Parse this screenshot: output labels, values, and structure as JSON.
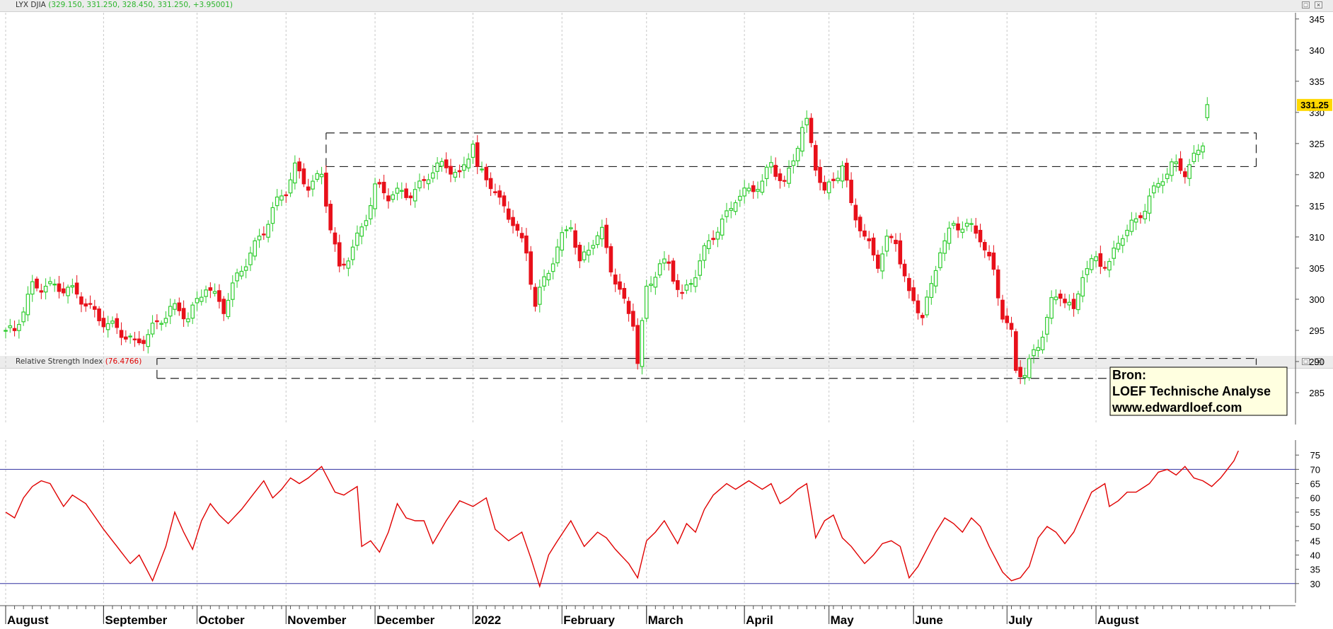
{
  "panels": {
    "price": {
      "symbol": "LYX DJIA",
      "values_text": "(329.150, 331.250, 328.450, 331.250, +3.95001)",
      "values_color": "#2bb52b",
      "last_price": "331.25",
      "last_price_bg": "#ffd800"
    },
    "rsi": {
      "title": "Relative Strength Index",
      "value_text": "(76.4766)",
      "value_color": "#e00000"
    }
  },
  "window_buttons": {
    "restore": "□",
    "close": "×"
  },
  "source_box": {
    "line1": "Bron:",
    "line2": "LOEF Technische Analyse",
    "line3": "www.edwardloef.com"
  },
  "colors": {
    "up": "#2ecc2e",
    "down": "#e8101a",
    "rsi_line": "#e00000",
    "rsi_levels": "#3030a0",
    "grid": "#c8c8c8"
  },
  "chart_data": [
    {
      "type": "candlestick",
      "y_ticks": [
        "285",
        "290",
        "295",
        "300",
        "305",
        "310",
        "315",
        "320",
        "325",
        "330",
        "335",
        "340",
        "345"
      ],
      "ylim": [
        280,
        346
      ],
      "x_labels": [
        "August",
        "September",
        "October",
        "November",
        "December",
        "2022",
        "February",
        "March",
        "April",
        "May",
        "June",
        "July",
        "August"
      ],
      "month_positions": [
        0,
        22,
        43,
        63,
        83,
        105,
        125,
        144,
        166,
        185,
        204,
        225,
        245
      ],
      "anchors": [
        [
          0,
          295
        ],
        [
          2,
          294
        ],
        [
          6,
          302
        ],
        [
          9,
          303
        ],
        [
          14,
          301
        ],
        [
          19,
          299
        ],
        [
          22,
          297
        ],
        [
          26,
          294
        ],
        [
          29,
          292.5
        ],
        [
          33,
          296
        ],
        [
          37,
          298
        ],
        [
          41,
          297
        ],
        [
          45,
          303
        ],
        [
          49,
          298
        ],
        [
          52,
          303
        ],
        [
          55,
          308
        ],
        [
          60,
          314
        ],
        [
          63,
          317
        ],
        [
          65,
          321
        ],
        [
          68,
          319
        ],
        [
          71,
          320
        ],
        [
          73,
          311
        ],
        [
          75,
          304
        ],
        [
          77,
          307
        ],
        [
          80,
          312
        ],
        [
          83,
          318
        ],
        [
          86,
          316
        ],
        [
          89,
          317
        ],
        [
          92,
          318
        ],
        [
          95,
          320
        ],
        [
          99,
          321
        ],
        [
          102,
          320
        ],
        [
          105,
          326
        ],
        [
          106,
          321
        ],
        [
          109,
          318
        ],
        [
          111,
          315
        ],
        [
          114,
          313
        ],
        [
          117,
          308
        ],
        [
          119,
          299
        ],
        [
          122,
          304
        ],
        [
          125,
          310
        ],
        [
          127,
          313
        ],
        [
          129,
          306
        ],
        [
          132,
          309
        ],
        [
          134,
          310
        ],
        [
          136,
          305
        ],
        [
          139,
          300
        ],
        [
          141,
          297
        ],
        [
          142,
          290
        ],
        [
          144,
          301
        ],
        [
          147,
          305
        ],
        [
          149,
          306
        ],
        [
          152,
          301
        ],
        [
          155,
          304
        ],
        [
          157,
          307
        ],
        [
          159,
          310
        ],
        [
          162,
          314
        ],
        [
          164,
          317
        ],
        [
          167,
          317
        ],
        [
          170,
          318
        ],
        [
          172,
          322
        ],
        [
          175,
          319
        ],
        [
          177,
          323
        ],
        [
          179,
          327
        ],
        [
          180,
          327.5
        ],
        [
          182,
          321
        ],
        [
          184,
          317
        ],
        [
          186,
          320
        ],
        [
          188,
          322
        ],
        [
          190,
          315
        ],
        [
          193,
          309
        ],
        [
          196,
          306
        ],
        [
          198,
          310
        ],
        [
          200,
          310
        ],
        [
          203,
          300
        ],
        [
          206,
          297
        ],
        [
          208,
          302
        ],
        [
          210,
          309
        ],
        [
          213,
          312
        ],
        [
          216,
          311
        ],
        [
          219,
          310
        ],
        [
          222,
          305
        ],
        [
          224,
          298
        ],
        [
          226,
          294
        ],
        [
          227,
          288
        ],
        [
          229,
          287.5
        ],
        [
          232,
          293
        ],
        [
          235,
          300
        ],
        [
          237,
          301
        ],
        [
          240,
          297
        ],
        [
          242,
          304
        ],
        [
          245,
          307
        ],
        [
          248,
          306
        ],
        [
          251,
          310
        ],
        [
          254,
          312
        ],
        [
          257,
          317
        ],
        [
          260,
          320
        ],
        [
          262,
          321
        ],
        [
          265,
          320
        ],
        [
          268,
          324
        ],
        [
          269,
          326
        ],
        [
          270,
          331.25
        ]
      ],
      "resistance_band": [
        321.3,
        326.7
      ],
      "resistance_band_x": [
        72,
        281
      ],
      "support_band": [
        287.3,
        290.5
      ],
      "support_band_x": [
        34,
        281
      ]
    },
    {
      "type": "line",
      "title": "Relative Strength Index",
      "y_ticks": [
        "30",
        "35",
        "40",
        "45",
        "50",
        "55",
        "60",
        "65",
        "70",
        "75"
      ],
      "ylim": [
        24,
        80
      ],
      "levels": [
        30,
        70
      ],
      "current": 76.4766,
      "anchors": [
        [
          0,
          55
        ],
        [
          2,
          53
        ],
        [
          4,
          60
        ],
        [
          6,
          64
        ],
        [
          8,
          66
        ],
        [
          10,
          65
        ],
        [
          13,
          57
        ],
        [
          15,
          61
        ],
        [
          18,
          58
        ],
        [
          22,
          49
        ],
        [
          25,
          43
        ],
        [
          28,
          37
        ],
        [
          30,
          40
        ],
        [
          33,
          31
        ],
        [
          36,
          43
        ],
        [
          38,
          55
        ],
        [
          40,
          48
        ],
        [
          42,
          42
        ],
        [
          44,
          52
        ],
        [
          46,
          58
        ],
        [
          48,
          54
        ],
        [
          50,
          51
        ],
        [
          53,
          56
        ],
        [
          56,
          62
        ],
        [
          58,
          66
        ],
        [
          60,
          60
        ],
        [
          62,
          63
        ],
        [
          64,
          67
        ],
        [
          66,
          65
        ],
        [
          68,
          67
        ],
        [
          71,
          71
        ],
        [
          74,
          62
        ],
        [
          76,
          61
        ],
        [
          79,
          64
        ],
        [
          80,
          43
        ],
        [
          82,
          45
        ],
        [
          84,
          41
        ],
        [
          86,
          48
        ],
        [
          88,
          58
        ],
        [
          90,
          53
        ],
        [
          92,
          52
        ],
        [
          94,
          52
        ],
        [
          96,
          44
        ],
        [
          99,
          52
        ],
        [
          102,
          59
        ],
        [
          105,
          57
        ],
        [
          108,
          60
        ],
        [
          110,
          49
        ],
        [
          113,
          45
        ],
        [
          116,
          48
        ],
        [
          118,
          39
        ],
        [
          120,
          29
        ],
        [
          122,
          40
        ],
        [
          124,
          45
        ],
        [
          127,
          52
        ],
        [
          130,
          43
        ],
        [
          133,
          48
        ],
        [
          135,
          46
        ],
        [
          137,
          42
        ],
        [
          140,
          37
        ],
        [
          142,
          32
        ],
        [
          144,
          45
        ],
        [
          146,
          48
        ],
        [
          148,
          52
        ],
        [
          151,
          44
        ],
        [
          153,
          51
        ],
        [
          155,
          48
        ],
        [
          157,
          56
        ],
        [
          159,
          61
        ],
        [
          162,
          65
        ],
        [
          164,
          63
        ],
        [
          167,
          66
        ],
        [
          170,
          63
        ],
        [
          172,
          65
        ],
        [
          174,
          58
        ],
        [
          176,
          60
        ],
        [
          178,
          63
        ],
        [
          180,
          65
        ],
        [
          182,
          46
        ],
        [
          184,
          52
        ],
        [
          186,
          54
        ],
        [
          188,
          46
        ],
        [
          190,
          43
        ],
        [
          193,
          37
        ],
        [
          195,
          40
        ],
        [
          197,
          44
        ],
        [
          199,
          45
        ],
        [
          201,
          43
        ],
        [
          203,
          32
        ],
        [
          205,
          36
        ],
        [
          207,
          42
        ],
        [
          209,
          48
        ],
        [
          211,
          53
        ],
        [
          213,
          51
        ],
        [
          215,
          48
        ],
        [
          217,
          53
        ],
        [
          219,
          50
        ],
        [
          221,
          43
        ],
        [
          224,
          34
        ],
        [
          226,
          31
        ],
        [
          228,
          32
        ],
        [
          230,
          36
        ],
        [
          232,
          46
        ],
        [
          234,
          50
        ],
        [
          236,
          48
        ],
        [
          238,
          44
        ],
        [
          240,
          48
        ],
        [
          242,
          55
        ],
        [
          244,
          62
        ],
        [
          246,
          64
        ],
        [
          247,
          65
        ],
        [
          248,
          57
        ],
        [
          250,
          59
        ],
        [
          252,
          62
        ],
        [
          254,
          62
        ],
        [
          257,
          65
        ],
        [
          259,
          69
        ],
        [
          261,
          70
        ],
        [
          263,
          68
        ],
        [
          265,
          71
        ],
        [
          267,
          67
        ],
        [
          269,
          66
        ],
        [
          271,
          64
        ],
        [
          273,
          67
        ],
        [
          276,
          73
        ],
        [
          277,
          76.5
        ]
      ]
    }
  ]
}
